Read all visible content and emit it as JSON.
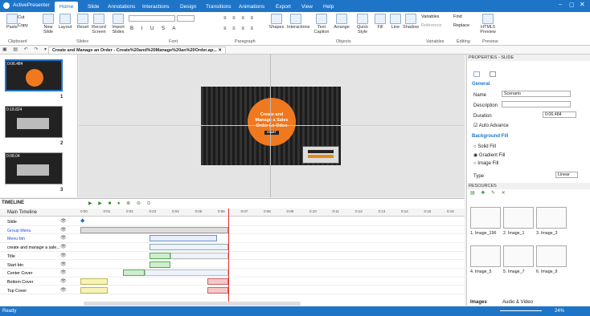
{
  "app": {
    "name": "ActivePresenter"
  },
  "tabs": [
    "Home",
    "Slide",
    "Annotations",
    "Interactions",
    "Design",
    "Transitions",
    "Animations",
    "Export",
    "View",
    "Help"
  ],
  "ribbon": {
    "buttons": [
      "Paste",
      "New Slide",
      "Layout",
      "Reset",
      "Record Screen",
      "Import Slides",
      "Shapes",
      "Interactions",
      "Text Caption",
      "Arrange",
      "Quick Style",
      "Fill",
      "Line",
      "Shadow",
      "HTML5 Preview"
    ],
    "cut": "Cut",
    "copy": "Copy",
    "variables": "Variables",
    "reference": "Reference",
    "find": "Find",
    "replace": "Replace",
    "groups": [
      "Clipboard",
      "Slides",
      "Font",
      "Paragraph",
      "Objects",
      "Variables",
      "Editing",
      "Preview"
    ]
  },
  "document": {
    "tab_title": "Create and Manage an Order - Create%20and%20Manage%20an%20Order.ap..."
  },
  "slides": [
    {
      "time": "0:06.484",
      "num": "1"
    },
    {
      "time": "0:18.824",
      "num": "2"
    },
    {
      "time": "0:08.04",
      "num": "3"
    }
  ],
  "slide_text": {
    "title": "Create and Manage a Sales Order Lo Odoo",
    "start": "START"
  },
  "properties": {
    "title": "PROPERTIES - SLIDE",
    "general": "General",
    "name_label": "Name",
    "name_value": "Scenario",
    "description_label": "Description",
    "duration_label": "Duration",
    "duration_value": "0:06.484",
    "auto_advance": "Auto Advance",
    "background_fill": "Background Fill",
    "solid": "Solid Fill",
    "gradient": "Gradient Fill",
    "image": "Image Fill",
    "type_label": "Type",
    "type_value": "Linear"
  },
  "timeline": {
    "title": "TIMELINE",
    "ticks": [
      "0:00",
      "0:01",
      "0:02",
      "0:03",
      "0:04",
      "0:05",
      "0:06",
      "0:07",
      "0:08",
      "0:09",
      "0:10",
      "0:11",
      "0:12",
      "0:13",
      "0:14",
      "0:15",
      "0:16"
    ],
    "main": "Main Timeline",
    "rows": [
      {
        "label": "Slide",
        "color": "#000"
      },
      {
        "label": "Group Menu",
        "color": "#1a55c8"
      },
      {
        "label": "Menu btn",
        "color": "#1a55c8"
      },
      {
        "label": "create and manage a sale...",
        "color": "#000"
      },
      {
        "label": "Title",
        "color": "#000"
      },
      {
        "label": "Start btn",
        "color": "#000"
      },
      {
        "label": "Center Cover",
        "color": "#000"
      },
      {
        "label": "Bottom Cover",
        "color": "#000"
      },
      {
        "label": "Top Cover",
        "color": "#000"
      }
    ]
  },
  "resources": {
    "title": "RESOURCES",
    "items": [
      "1. Image_196",
      "2. Image_1",
      "3. Image_3",
      "4. Image_5",
      "5. Image_7",
      "6. Image_9"
    ],
    "tab_images": "Images",
    "tab_audio": "Audio & Video"
  },
  "status": {
    "ready": "Ready",
    "zoom": "24%"
  }
}
